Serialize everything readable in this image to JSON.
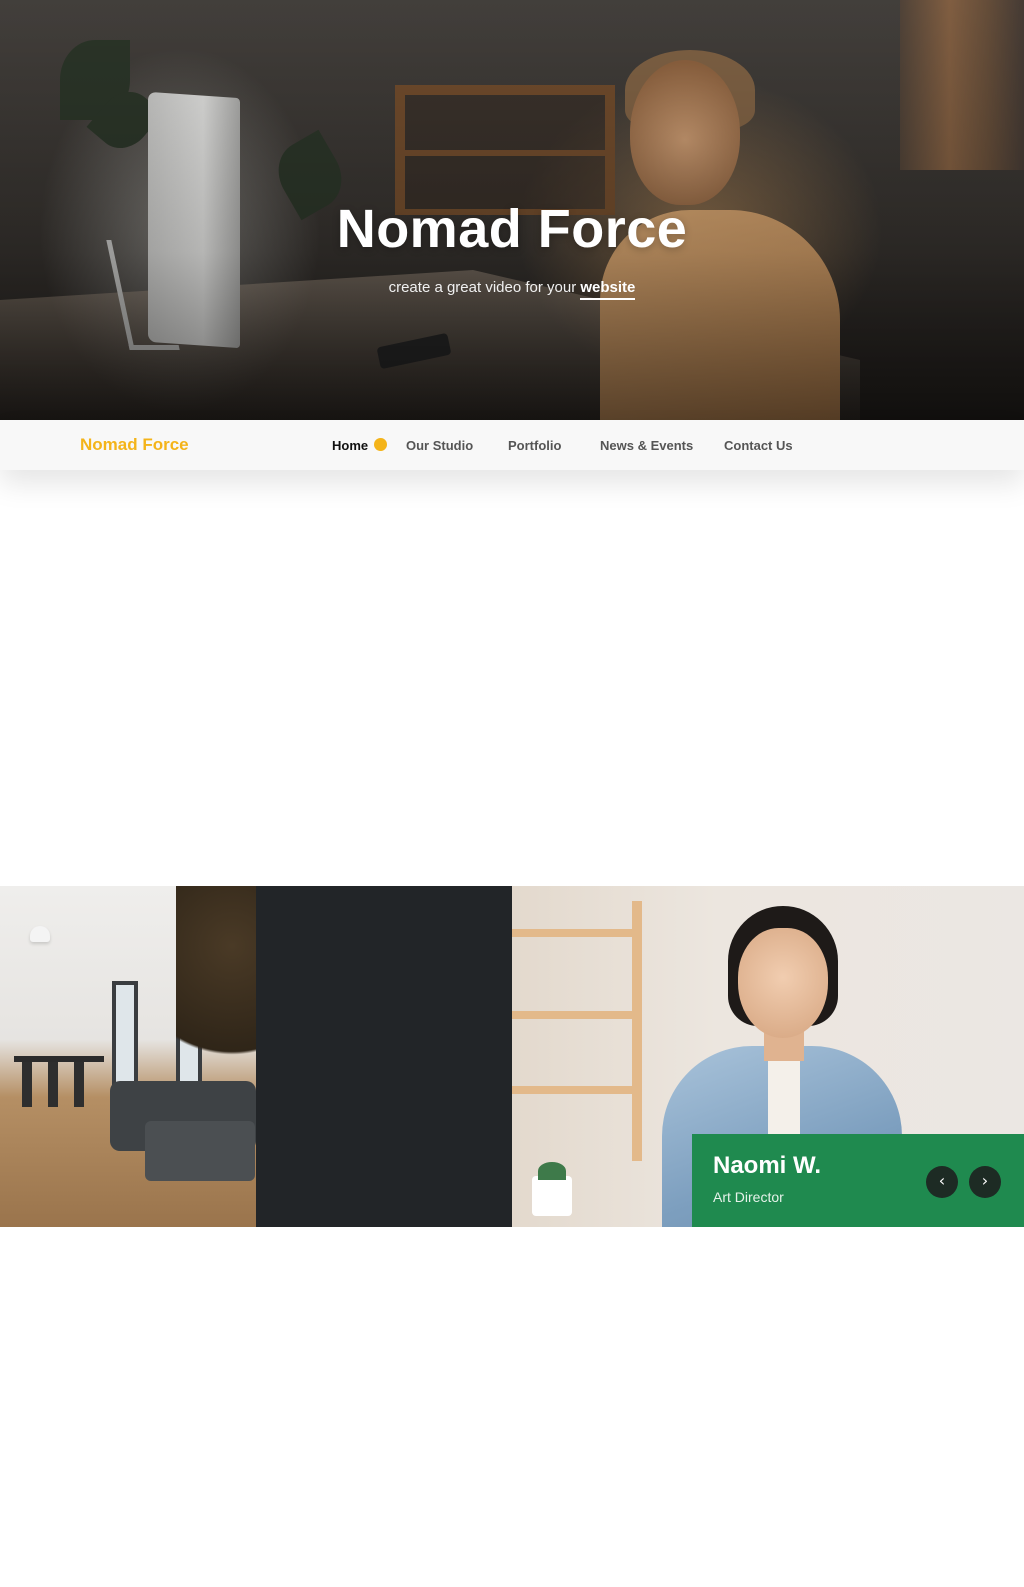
{
  "hero": {
    "title": "Nomad Force",
    "subtitle_prefix": "create a great video for your ",
    "subtitle_highlight": "website"
  },
  "nav": {
    "brand": "Nomad Force",
    "items": [
      {
        "label": "Home",
        "active": true
      },
      {
        "label": "Our Studio",
        "active": false
      },
      {
        "label": "Portfolio",
        "active": false
      },
      {
        "label": "News & Events",
        "active": false
      },
      {
        "label": "Contact Us",
        "active": false
      }
    ]
  },
  "team_slider": {
    "name": "Naomi W.",
    "role": "Art Director",
    "prev_icon": "chevron-left-icon",
    "next_icon": "chevron-right-icon"
  },
  "colors": {
    "accent": "#f4b41a",
    "caption_green": "#1f8a4f",
    "dark_panel": "#222528"
  }
}
